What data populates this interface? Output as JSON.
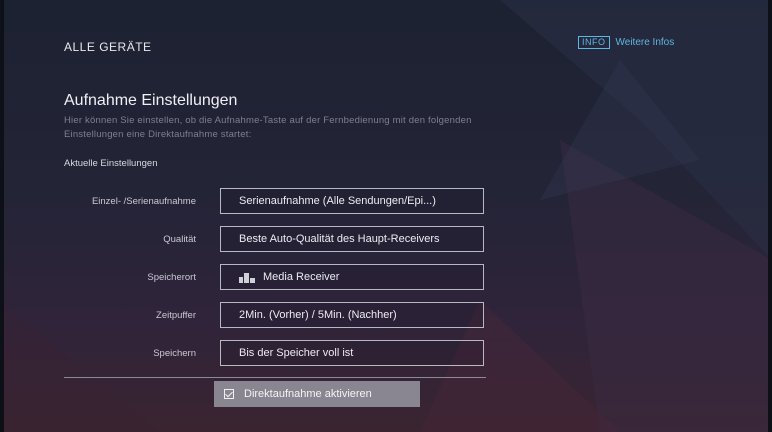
{
  "header": {
    "title": "ALLE GERÄTE",
    "info_badge": "INFO",
    "info_link": "Weitere Infos"
  },
  "section": {
    "title": "Aufnahme Einstellungen",
    "description": "Hier können Sie einstellen, ob die Aufnahme-Taste auf der Fernbedienung mit den folgenden Einstellungen eine Direktaufnahme startet:",
    "current_label": "Aktuelle Einstellungen"
  },
  "settings": [
    {
      "label": "Einzel- /Serienaufnahme",
      "value": "Serienaufnahme (Alle Sendungen/Epi...)"
    },
    {
      "label": "Qualität",
      "value": "Beste Auto-Qualität des Haupt-Receivers"
    },
    {
      "label": "Speicherort",
      "value": "Media Receiver",
      "icon": "media-receiver-icon"
    },
    {
      "label": "Zeitpuffer",
      "value": "2Min. (Vorher) / 5Min. (Nachher)"
    },
    {
      "label": "Speichern",
      "value": "Bis der Speicher voll ist"
    }
  ],
  "direct_recording": {
    "label": "Direktaufnahme aktivieren",
    "checked": true
  },
  "colors": {
    "accent": "#5fb6e0",
    "focus_button": "#8a8691"
  }
}
